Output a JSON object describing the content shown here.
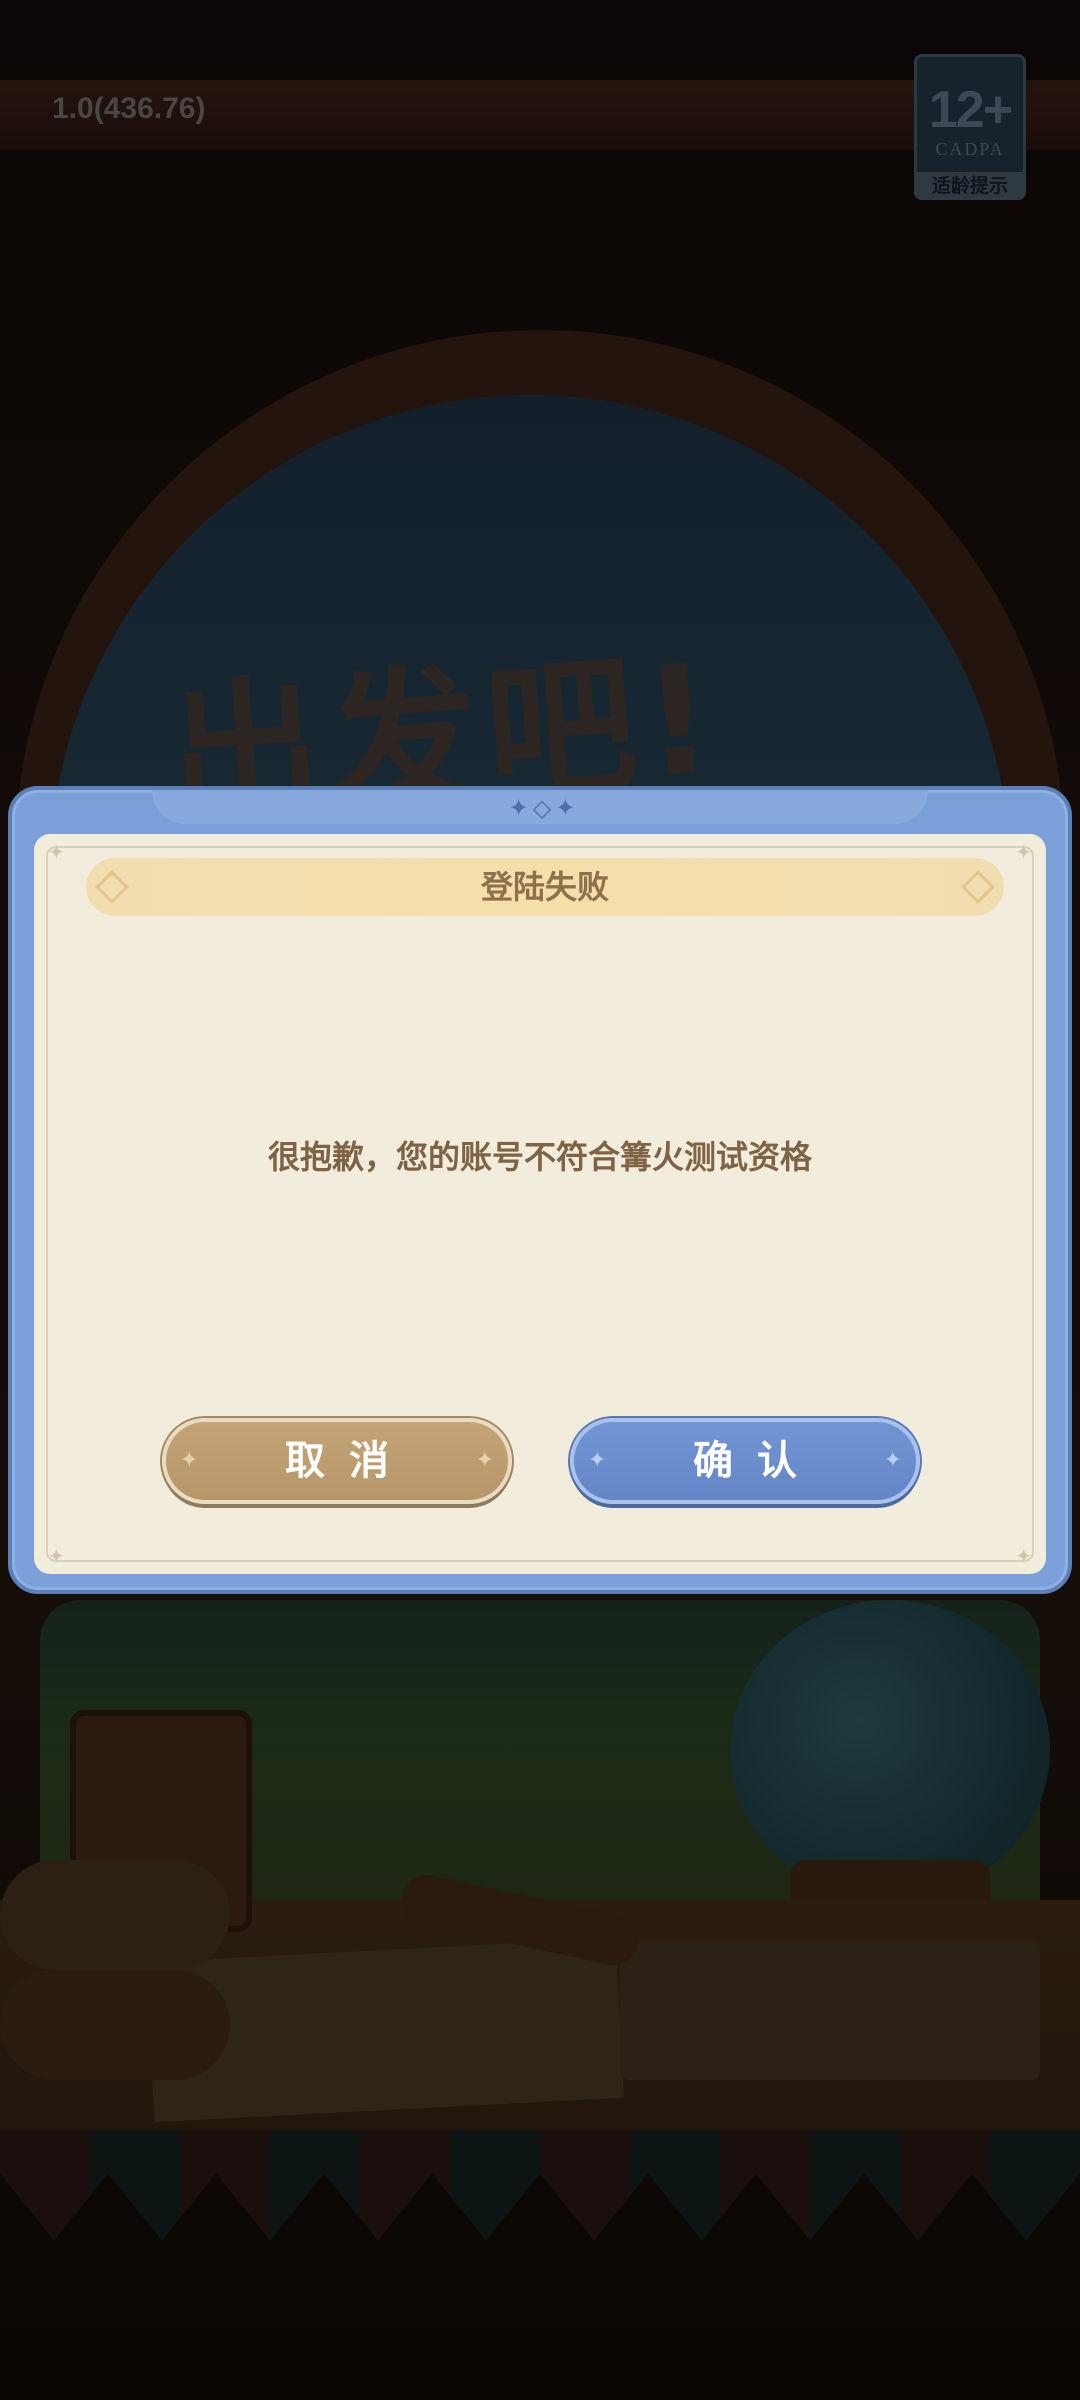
{
  "hud": {
    "version": "1.0(436.76)",
    "age_rating": "12+",
    "age_org": "CADPA",
    "age_tip": "适龄提示"
  },
  "background": {
    "logo_text": "出发吧!"
  },
  "dialog": {
    "title": "登陆失败",
    "message": "很抱歉，您的账号不符合篝火测试资格",
    "cancel_label": "取消",
    "confirm_label": "确认"
  },
  "colors": {
    "frame_blue": "#7b9fd8",
    "panel_cream": "#f2ecdc",
    "title_text": "#8f6f4c",
    "cancel_button": "#b7966a",
    "confirm_button": "#6586c6"
  },
  "icons": {
    "frame_ornament": "sparkle-icon",
    "corner": "star-icon",
    "ribbon": "diamond-icon",
    "button_deco": "sparkle-icon"
  }
}
